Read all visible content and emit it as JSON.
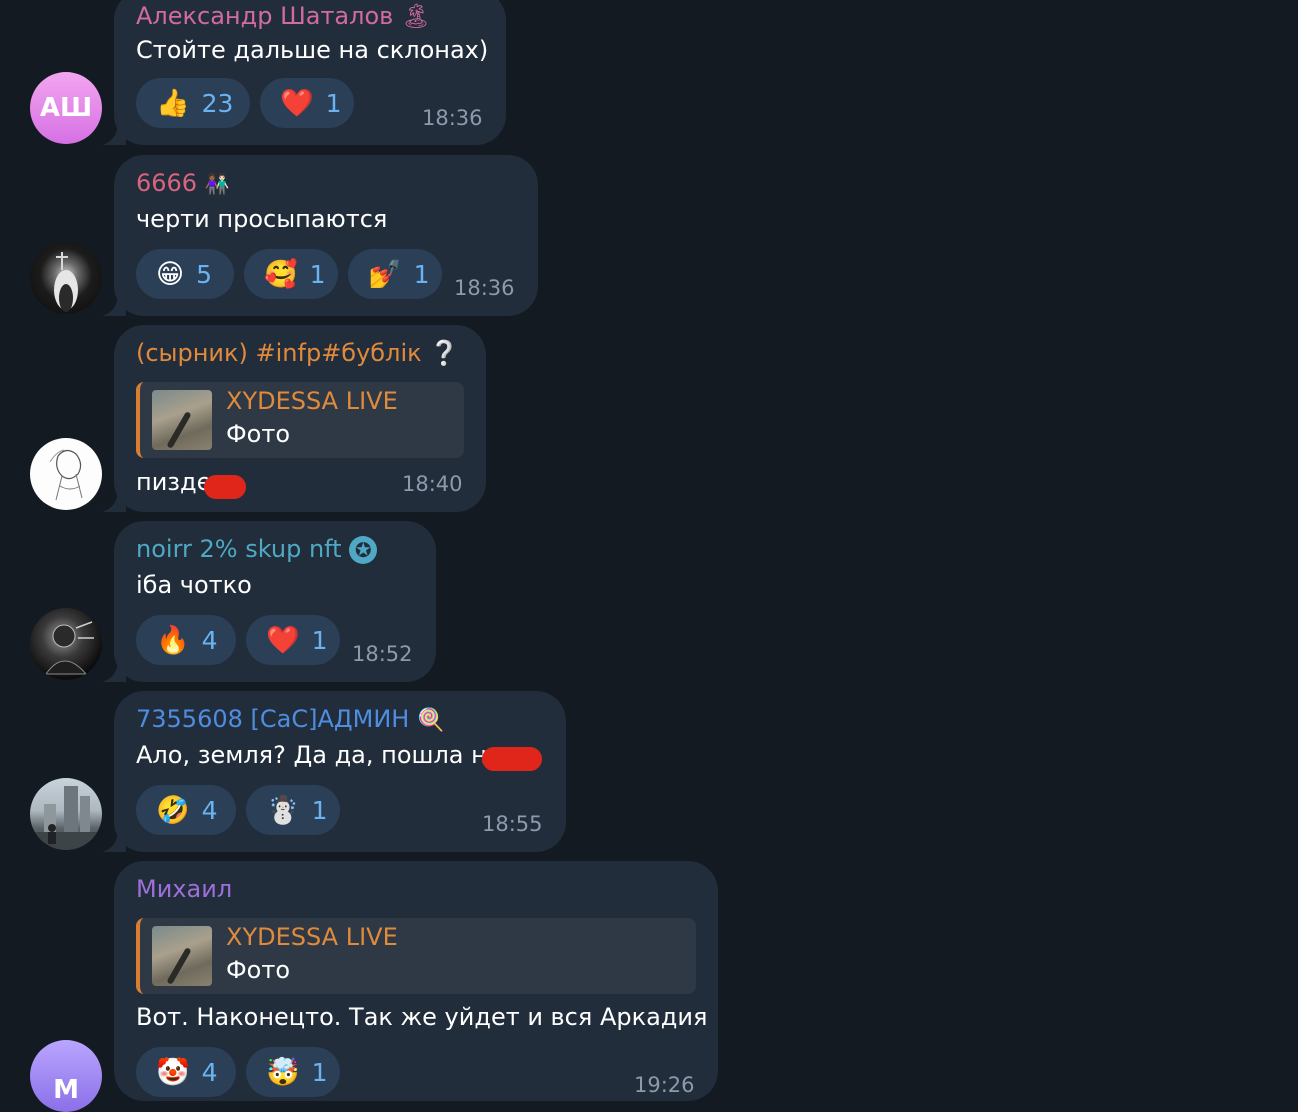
{
  "messages": [
    {
      "author": "Александр Шаталов",
      "author_emoji": "🏝",
      "text": "Стойте дальше на склонах)",
      "reactions": [
        {
          "emoji": "👍",
          "count": "23"
        },
        {
          "emoji": "❤️",
          "count": "1"
        }
      ],
      "time": "18:36",
      "avatar_initials": "АШ"
    },
    {
      "author": "6666",
      "author_emoji": "👩🏾‍🤝‍👨🏻",
      "text": "черти просыпаются",
      "reactions": [
        {
          "emoji": "😁",
          "count": "5"
        },
        {
          "emoji": "🥰",
          "count": "1"
        },
        {
          "emoji": "💅",
          "count": "1"
        }
      ],
      "time": "18:36"
    },
    {
      "author": "(сырник) #infp#бублік",
      "author_emoji": "❔",
      "reply": {
        "title": "XYDESSA LIVE",
        "subtitle": "Фото"
      },
      "text": "пизде",
      "time": "18:40"
    },
    {
      "author": "noirr 2% skup nft",
      "author_emoji": "✪",
      "text": "іба чотко",
      "reactions": [
        {
          "emoji": "🔥",
          "count": "4"
        },
        {
          "emoji": "❤️",
          "count": "1"
        }
      ],
      "time": "18:52"
    },
    {
      "author": "7355608 [CaC]АДМИН",
      "author_emoji": "🍭",
      "text": "Ало, земля? Да да, пошла на",
      "reactions": [
        {
          "emoji": "🤣",
          "count": "4"
        },
        {
          "emoji": "☃️",
          "count": "1"
        }
      ],
      "time": "18:55"
    },
    {
      "author": "Михаил",
      "reply": {
        "title": "XYDESSA LIVE",
        "subtitle": "Фото"
      },
      "text": "Вот. Наконецто. Так же уйдет и вся Аркадия",
      "reactions": [
        {
          "emoji": "🤡",
          "count": "4"
        },
        {
          "emoji": "🤯",
          "count": "1"
        }
      ],
      "time": "19:26",
      "avatar_initials": "М"
    }
  ],
  "colors": {
    "background": "#131a22",
    "bubble": "#212d3b",
    "reaction_bg": "#2b3f57",
    "count": "#6ab3f3",
    "time": "#8c9aab",
    "name1": "#d26b9e",
    "name2": "#d8647e",
    "name3": "#e08a3c",
    "name4": "#4fa8c4",
    "name5": "#4f8de0",
    "name6": "#9d6fd8",
    "reply_accent": "#d97d35"
  }
}
